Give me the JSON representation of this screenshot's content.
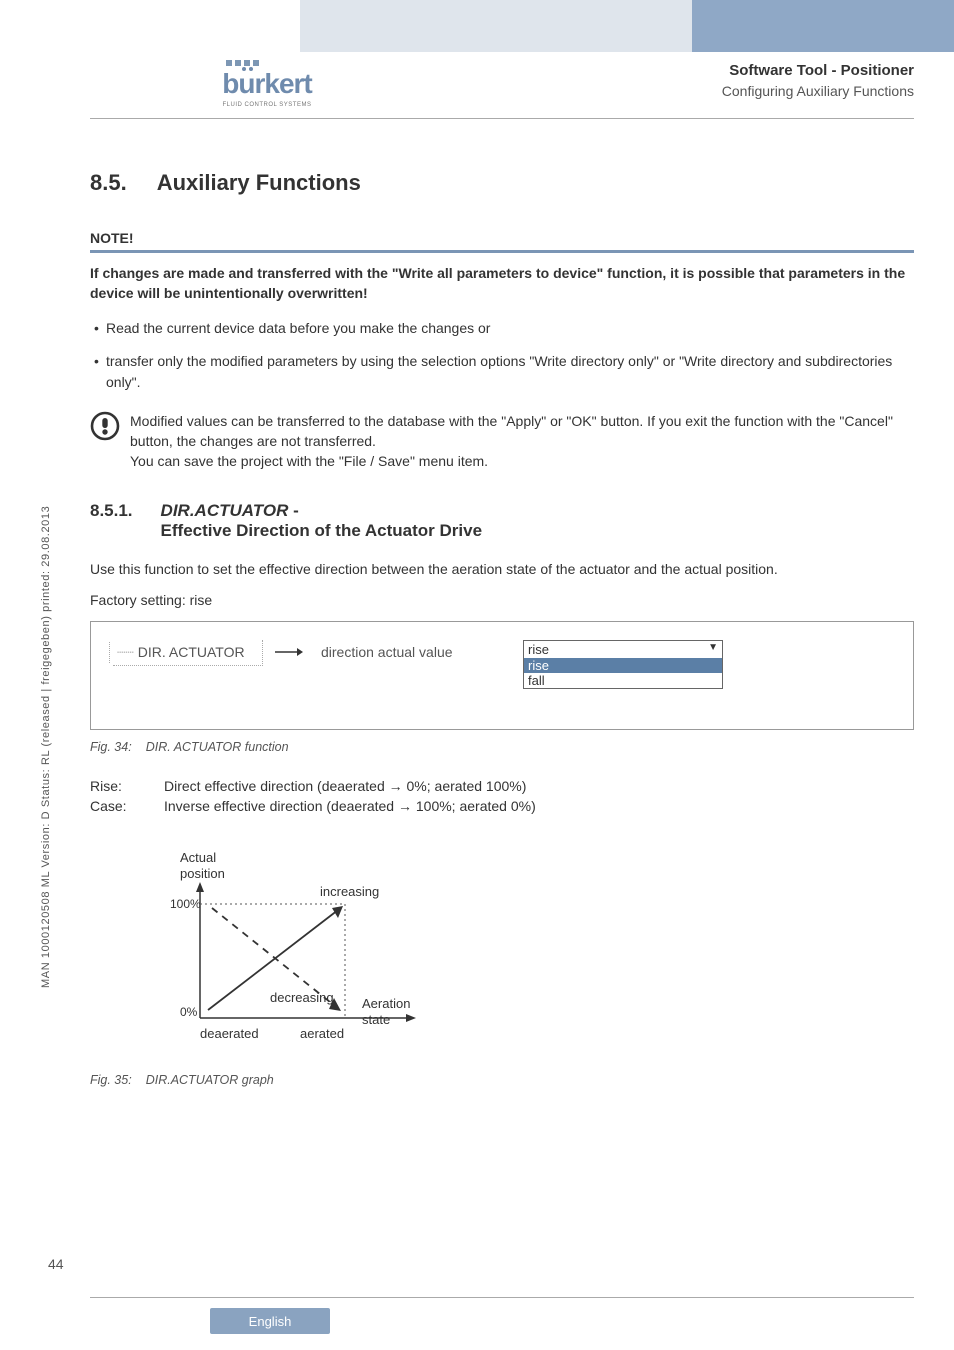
{
  "header": {
    "logo_text": "burkert",
    "logo_sub": "FLUID CONTROL SYSTEMS",
    "right_title": "Software Tool - Positioner",
    "right_sub": "Configuring Auxiliary Functions"
  },
  "section": {
    "number": "8.5.",
    "title": "Auxiliary Functions"
  },
  "note": {
    "label": "NOTE!",
    "bold": "If changes are made and transferred with the \"Write all parameters to device\" function, it is possible that parameters in the device will be unintentionally overwritten!",
    "bullets": [
      "Read the current device data before you make the changes or",
      "transfer only the modified parameters by using the selection options \"Write directory only\" or \"Write directory and subdirectories only\"."
    ]
  },
  "info_text": "Modified values can be transferred to the database with the \"Apply\" or \"OK\" button. If you exit the function with the \"Cancel\" button, the changes are not transferred.\nYou can save the project with the \"File / Save\" menu item.",
  "subsection": {
    "number": "8.5.1.",
    "title_italic": "DIR.ACTUATOR",
    "title_dash": " - ",
    "title_rest": "Effective Direction of the Actuator Drive"
  },
  "para1": "Use this function to set the effective direction between the aeration state of the actuator and the actual position.",
  "para2": "Factory setting: rise",
  "config": {
    "label": "DIR. ACTUATOR",
    "field": "direction actual value",
    "selected": "rise",
    "options": [
      "rise",
      "fall"
    ]
  },
  "fig34": {
    "num": "Fig. 34:",
    "text": "DIR. ACTUATOR function"
  },
  "defs": {
    "rise_k": "Rise:",
    "rise_v": "Direct effective direction (deaerated → 0%; aerated 100%)",
    "case_k": "Case:",
    "case_v": "Inverse effective direction (deaerated → 100%; aerated 0%)"
  },
  "chart_data": {
    "type": "line",
    "title": "",
    "xlabel": "Aeration state",
    "ylabel": "Actual position",
    "x_categories": [
      "deaerated",
      "aerated"
    ],
    "y_ticks": [
      "0%",
      "100%"
    ],
    "series": [
      {
        "name": "increasing",
        "style": "solid-arrow",
        "points": [
          [
            0,
            0
          ],
          [
            1,
            1
          ]
        ]
      },
      {
        "name": "decreasing",
        "style": "dashed-arrow",
        "points": [
          [
            0,
            1
          ],
          [
            1,
            0
          ]
        ]
      }
    ],
    "annotations": [
      "increasing",
      "decreasing"
    ]
  },
  "fig35": {
    "num": "Fig. 35:",
    "text": "DIR.ACTUATOR graph"
  },
  "side_text": "MAN 1000120508 ML Version: D Status: RL (released | freigegeben) printed: 29.08.2013",
  "page_number": "44",
  "footer_lang": "English"
}
